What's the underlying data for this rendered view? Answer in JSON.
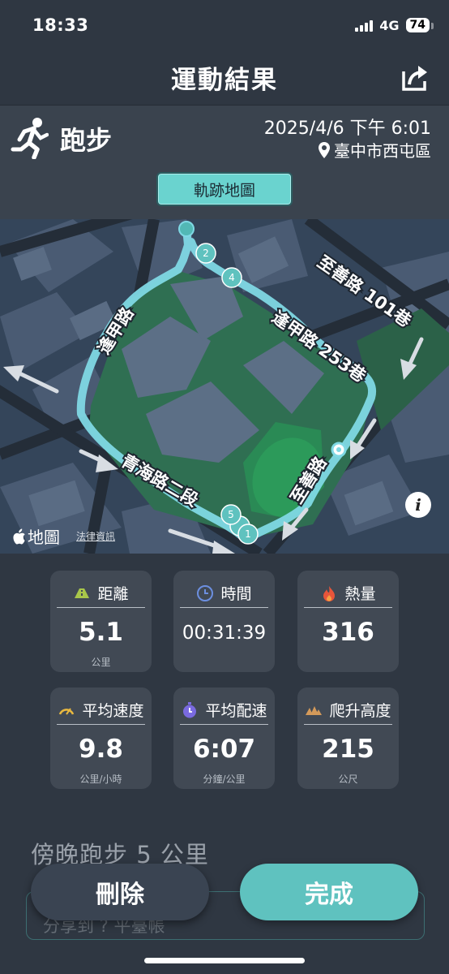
{
  "status_bar": {
    "time": "18:33",
    "network": "4G",
    "battery": "74"
  },
  "nav": {
    "title": "運動結果"
  },
  "activity": {
    "type": "跑步",
    "datetime": "2025/4/6 下午 6:01",
    "location": "臺中市西屯區",
    "track_button": "軌跡地圖"
  },
  "map": {
    "streets": [
      "至善路 101巷",
      "逢甲路",
      "逢甲路 253巷",
      "青海路二段",
      "至善路"
    ],
    "markers": [
      "2",
      "4",
      "5",
      "1"
    ],
    "logo": "地圖",
    "legal": "法律資訊",
    "info": "i",
    "route_color": "#7fd8e4"
  },
  "stats": [
    {
      "icon": "road-icon",
      "label": "距離",
      "value": "5.1",
      "unit": "公里"
    },
    {
      "icon": "clock-icon",
      "label": "時間",
      "value": "00:31:39",
      "unit": ""
    },
    {
      "icon": "flame-icon",
      "label": "熱量",
      "value": "316",
      "unit": ""
    },
    {
      "icon": "speedometer-icon",
      "label": "平均速度",
      "value": "9.8",
      "unit": "公里/小時"
    },
    {
      "icon": "stopwatch-icon",
      "label": "平均配速",
      "value": "6:07",
      "unit": "分鐘/公里"
    },
    {
      "icon": "mountain-icon",
      "label": "爬升高度",
      "value": "215",
      "unit": "公尺"
    }
  ],
  "workout_title": "傍晚跑步 5 公里",
  "share_text": "分享到 ? 平臺帳",
  "buttons": {
    "delete": "刪除",
    "done": "完成"
  }
}
